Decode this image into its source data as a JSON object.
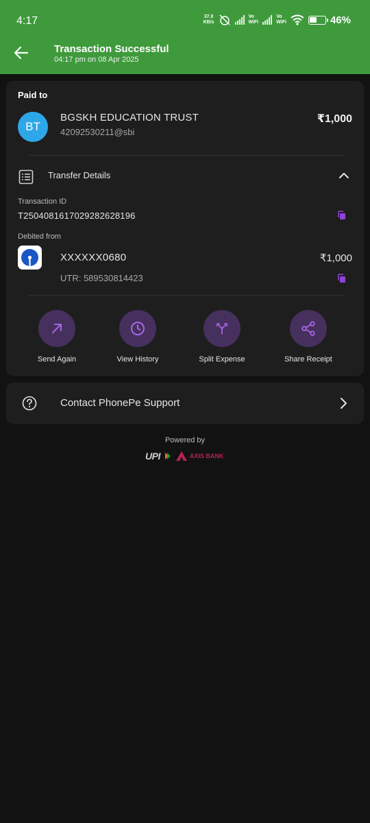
{
  "status_bar": {
    "time": "4:17",
    "speed_value": "37.0",
    "speed_unit": "KB/s",
    "vo_top": "Vo",
    "vo_bottom": "WiFi",
    "battery": "46%"
  },
  "header": {
    "title": "Transaction Successful",
    "subtitle": "04:17 pm on 08 Apr 2025"
  },
  "payment": {
    "paid_to_label": "Paid to",
    "avatar_initials": "BT",
    "payee_name": "BGSKH EDUCATION TRUST",
    "payee_upi": "42092530211@sbi",
    "amount": "₹1,000"
  },
  "transfer_details": {
    "label": "Transfer Details",
    "txn_id_label": "Transaction ID",
    "txn_id": "T2504081617029282628196",
    "debited_from_label": "Debited from",
    "account": "XXXXXX0680",
    "account_amount": "₹1,000",
    "utr": "UTR: 589530814423"
  },
  "actions": [
    {
      "label": "Send Again",
      "icon": "arrow-up-right-icon"
    },
    {
      "label": "View History",
      "icon": "clock-icon"
    },
    {
      "label": "Split Expense",
      "icon": "split-icon"
    },
    {
      "label": "Share Receipt",
      "icon": "share-icon"
    }
  ],
  "support": {
    "label": "Contact PhonePe Support"
  },
  "footer": {
    "powered_by": "Powered by",
    "upi_logo_text": "UPI",
    "bank_logo_text": "AXIS BANK"
  },
  "colors": {
    "header_green": "#3f9a3c",
    "accent_purple": "#9b59d6",
    "avatar_blue": "#2ea7e8"
  }
}
